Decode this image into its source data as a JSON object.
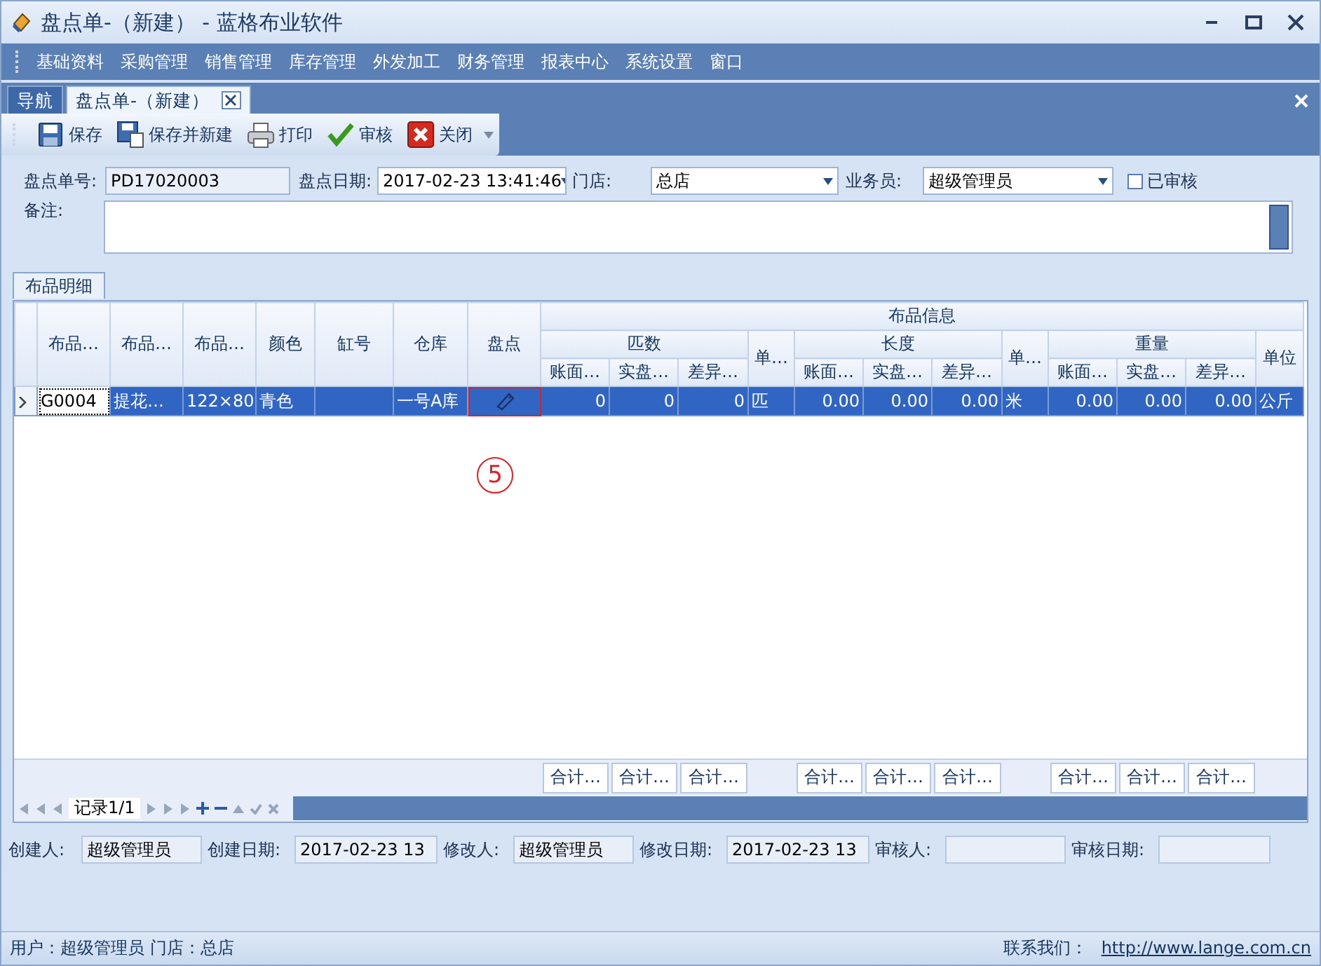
{
  "window": {
    "title": "盘点单-（新建） - 蓝格布业软件"
  },
  "menu": [
    "基础资料",
    "采购管理",
    "销售管理",
    "库存管理",
    "外发加工",
    "财务管理",
    "报表中心",
    "系统设置",
    "窗口"
  ],
  "tabs": [
    {
      "label": "导航",
      "selected": false,
      "closable": false
    },
    {
      "label": "盘点单-（新建）",
      "selected": true,
      "closable": true
    }
  ],
  "toolbar": [
    {
      "label": "保存",
      "kind": "save"
    },
    {
      "label": "保存并新建",
      "kind": "save-new"
    },
    {
      "label": "打印",
      "kind": "print"
    },
    {
      "label": "审核",
      "kind": "approve"
    },
    {
      "label": "关闭",
      "kind": "close"
    }
  ],
  "form": {
    "order_no": {
      "label": "盘点单号:",
      "value": "PD17020003"
    },
    "date": {
      "label": "盘点日期:",
      "value": "2017-02-23 13:41:46"
    },
    "store": {
      "label": "门店:",
      "value": "总店"
    },
    "clerk": {
      "label": "业务员:",
      "value": "超级管理员"
    },
    "approved": {
      "label": "已审核",
      "checked": false
    },
    "remark": {
      "label": "备注:"
    }
  },
  "detail_tab": {
    "label": "布品明细"
  },
  "grid": {
    "header_rows": [
      [
        {
          "label": "布品信息",
          "colspan": 12
        }
      ],
      [
        {
          "label": "匹数",
          "colspan": 3
        },
        {
          "kind": "gap"
        },
        {
          "label": "长度",
          "colspan": 3
        },
        {
          "kind": "gap"
        },
        {
          "label": "重量",
          "colspan": 3
        },
        {
          "kind": "gap"
        }
      ]
    ],
    "columns": [
      {
        "label": "布品…"
      },
      {
        "label": "布品…"
      },
      {
        "label": "布品…"
      },
      {
        "label": "颜色"
      },
      {
        "label": "缸号"
      },
      {
        "label": "仓库"
      },
      {
        "label": "盘点"
      },
      {
        "label": "账面…",
        "kind": "number",
        "total": "合计…"
      },
      {
        "label": "实盘…",
        "kind": "number",
        "total": "合计…"
      },
      {
        "label": "差异…",
        "kind": "number",
        "total": "合计…"
      },
      {
        "label": "单…"
      },
      {
        "label": "账面…",
        "kind": "number",
        "total": "合计…"
      },
      {
        "label": "实盘…",
        "kind": "number",
        "total": "合计…"
      },
      {
        "label": "差异…",
        "kind": "number",
        "total": "合计…"
      },
      {
        "label": "单…"
      },
      {
        "label": "账面…",
        "kind": "number",
        "total": "合计…"
      },
      {
        "label": "实盘…",
        "kind": "number",
        "total": "合计…"
      },
      {
        "label": "差异…",
        "kind": "number",
        "total": "合计…"
      },
      {
        "label": "单位"
      }
    ],
    "rows": [
      {
        "selected": true,
        "cells": [
          {
            "text": "G0004"
          },
          {
            "text": "提花…"
          },
          {
            "text": "122×80"
          },
          {
            "text": "青色"
          },
          {
            "kind": "blank"
          },
          {
            "text": "一号A库"
          },
          {
            "kind": "icon"
          },
          {
            "text": "0"
          },
          {
            "text": "0"
          },
          {
            "text": "0"
          },
          {
            "text": "匹"
          },
          {
            "text": "0.00"
          },
          {
            "text": "0.00"
          },
          {
            "text": "0.00"
          },
          {
            "text": "米"
          },
          {
            "text": "0.00"
          },
          {
            "text": "0.00"
          },
          {
            "text": "0.00"
          },
          {
            "text": "公斤"
          }
        ]
      }
    ],
    "navigator": {
      "label": "记录1/1"
    }
  },
  "annotation": {
    "label": "5"
  },
  "audit": [
    {
      "label": "创建人:",
      "value": "超级管理员"
    },
    {
      "label": "创建日期:",
      "value": "2017-02-23 13"
    },
    {
      "label": "修改人:",
      "value": "超级管理员"
    },
    {
      "label": "修改日期:",
      "value": "2017-02-23 13"
    },
    {
      "label": "审核人:"
    },
    {
      "label": "审核日期:"
    }
  ],
  "status_bar": {
    "user": "用户：超级管理员  门店：总店",
    "contact_label": "联系我们：",
    "contact_link": "http://www.lange.com.cn"
  }
}
